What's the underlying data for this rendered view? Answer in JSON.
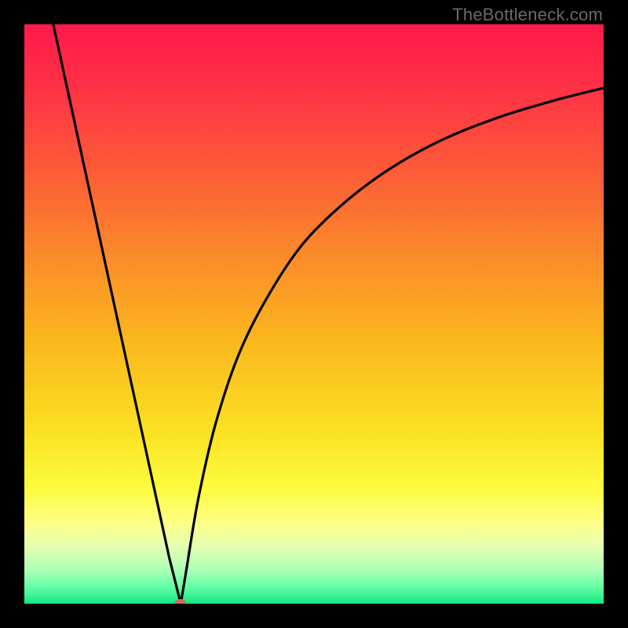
{
  "watermark": {
    "text": "TheBottleneck.com"
  },
  "colors": {
    "frame": "#000000",
    "gradient_stops": [
      {
        "offset": 0.0,
        "color": "#ff1a4b"
      },
      {
        "offset": 0.1,
        "color": "#ff2f46"
      },
      {
        "offset": 0.25,
        "color": "#fd5a38"
      },
      {
        "offset": 0.4,
        "color": "#fb8b2a"
      },
      {
        "offset": 0.55,
        "color": "#fbb81e"
      },
      {
        "offset": 0.7,
        "color": "#fbe022"
      },
      {
        "offset": 0.8,
        "color": "#fdfb3e"
      },
      {
        "offset": 0.86,
        "color": "#feff86"
      },
      {
        "offset": 0.9,
        "color": "#e6ffb0"
      },
      {
        "offset": 0.94,
        "color": "#b0ffb7"
      },
      {
        "offset": 0.97,
        "color": "#66ffa6"
      },
      {
        "offset": 1.0,
        "color": "#14e885"
      }
    ],
    "curve": "#000000",
    "vertex_dot": "#cf6a5e"
  },
  "chart_data": {
    "type": "line",
    "title": "",
    "xlabel": "",
    "ylabel": "",
    "xlim": [
      0,
      100
    ],
    "ylim": [
      0,
      100
    ],
    "grid": false,
    "legend": false,
    "series": [
      {
        "name": "left-branch",
        "x": [
          5,
          10,
          15,
          20,
          25,
          27
        ],
        "y": [
          100,
          77,
          54,
          31,
          8,
          0
        ]
      },
      {
        "name": "right-branch",
        "x": [
          27,
          28,
          30,
          33,
          37,
          42,
          48,
          55,
          63,
          72,
          82,
          92,
          100
        ],
        "y": [
          0,
          6,
          18,
          31,
          43,
          53,
          62,
          69,
          75,
          80,
          84,
          87,
          89
        ]
      }
    ],
    "annotations": [
      {
        "name": "vertex",
        "x": 27,
        "y": 0
      }
    ]
  }
}
